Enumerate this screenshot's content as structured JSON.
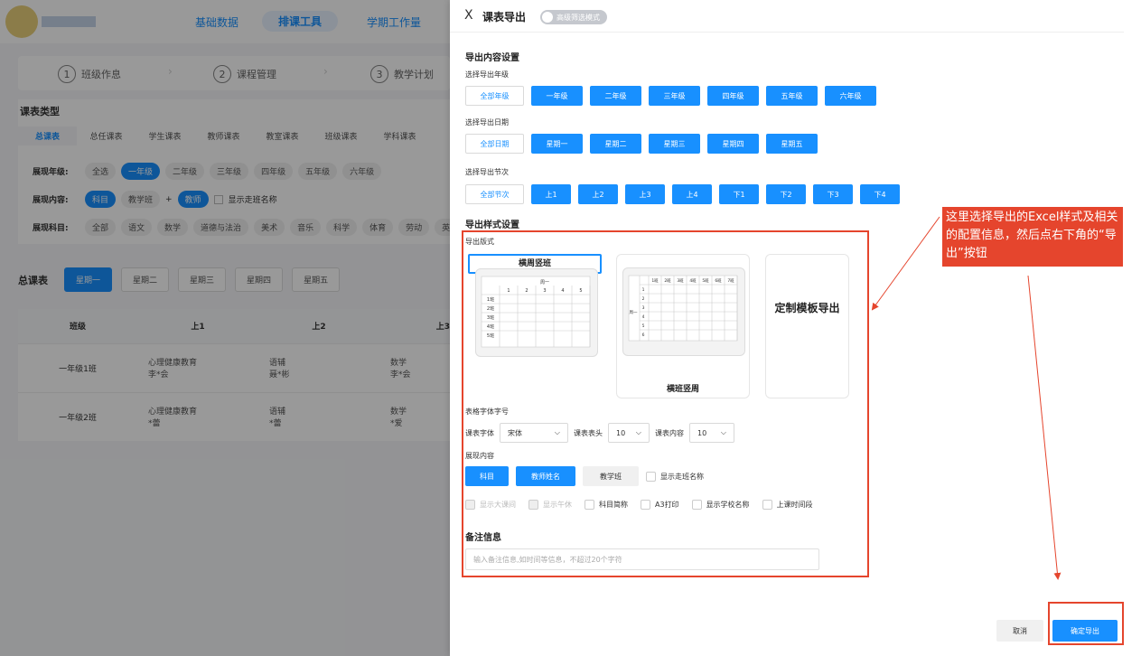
{
  "bg": {
    "nav": [
      "基础数据",
      "排课工具",
      "学期工作量"
    ],
    "steps": [
      {
        "num": "1",
        "label": "班级作息"
      },
      {
        "num": "2",
        "label": "课程管理"
      },
      {
        "num": "3",
        "label": "教学计划"
      }
    ],
    "section_title": "课表类型",
    "tabs": [
      "总课表",
      "总任课表",
      "学生课表",
      "教师课表",
      "教室课表",
      "班级课表",
      "学科课表"
    ],
    "grade_label": "展现年级:",
    "grades": [
      "全选",
      "一年级",
      "二年级",
      "三年级",
      "四年级",
      "五年级",
      "六年级"
    ],
    "content_label": "展现内容:",
    "content_items": [
      "科目",
      "教学班",
      "+",
      "教师",
      "显示走班名称"
    ],
    "subject_label": "展现科目:",
    "subjects": [
      "全部",
      "语文",
      "数学",
      "道德与法治",
      "美术",
      "音乐",
      "科学",
      "体育",
      "劳动",
      "英"
    ],
    "total_label": "总课表",
    "days": [
      "星期一",
      "星期二",
      "星期三",
      "星期四",
      "星期五"
    ],
    "table": {
      "headers": [
        "班级",
        "上1",
        "上2",
        "上3"
      ],
      "rows": [
        {
          "class": "一年级1班",
          "c1a": "心理健康教育",
          "c1b": "李*会",
          "c2a": "语辅",
          "c2b": "聂*彬",
          "c3a": "数学",
          "c3b": "李*会"
        },
        {
          "class": "一年级2班",
          "c1a": "心理健康教育",
          "c1b": "*蕾",
          "c2a": "语辅",
          "c2b": "*蕾",
          "c3a": "数学",
          "c3b": "*爱"
        }
      ]
    }
  },
  "drawer": {
    "close": "X",
    "title": "课表导出",
    "switch_label": "高级筛选模式",
    "content_section": "导出内容设置",
    "grade_label": "选择导出年级",
    "grade_all": "全部年级",
    "grades": [
      "一年级",
      "二年级",
      "三年级",
      "四年级",
      "五年级",
      "六年级"
    ],
    "date_label": "选择导出日期",
    "date_all": "全部日期",
    "dates": [
      "星期一",
      "星期二",
      "星期三",
      "星期四",
      "星期五"
    ],
    "period_label": "选择导出节次",
    "period_all": "全部节次",
    "periods": [
      "上1",
      "上2",
      "上3",
      "上4",
      "下1",
      "下2",
      "下3",
      "下4"
    ],
    "style_section": "导出样式设置",
    "format_label": "导出版式",
    "cards": [
      "横周竖班",
      "横班竖周",
      "定制模板导出"
    ],
    "mini1_title": "周一",
    "mini1_cols": [
      "1",
      "2",
      "3",
      "4",
      "5"
    ],
    "mini1_rows": [
      "1班",
      "2班",
      "3班",
      "4班",
      "5班"
    ],
    "mini2_cols": [
      "1班",
      "2班",
      "3班",
      "4班",
      "5班",
      "6班",
      "7班"
    ],
    "mini2_side": "周一",
    "mini2_rows": [
      "1",
      "2",
      "3",
      "4",
      "5",
      "6"
    ],
    "font_section": "表格字体字号",
    "font_label": "课表字体",
    "font_value": "宋体",
    "header_label": "课表表头",
    "header_size": "10",
    "body_label": "课表内容",
    "body_size": "10",
    "display_section": "展现内容",
    "display_items": [
      "科目",
      "教师姓名",
      "教学班"
    ],
    "show_walk": "显示走班名称",
    "checks": [
      {
        "label": "显示大课间",
        "disabled": true
      },
      {
        "label": "显示午休",
        "disabled": true
      },
      {
        "label": "科目简称",
        "disabled": false
      },
      {
        "label": "A3打印",
        "disabled": false
      },
      {
        "label": "显示学校名称",
        "disabled": false
      },
      {
        "label": "上课时间段",
        "disabled": false
      }
    ],
    "remark_section": "备注信息",
    "remark_placeholder": "输入备注信息,如时间等信息，不超过20个字符",
    "cancel": "取消",
    "confirm": "确定导出"
  },
  "annotation": {
    "text": "这里选择导出的Excel样式及相关的配置信息，然后点右下角的“导出”按钮",
    "color": "#e5452d"
  },
  "colors": {
    "primary": "#1890ff",
    "annotation": "#e5452d"
  }
}
